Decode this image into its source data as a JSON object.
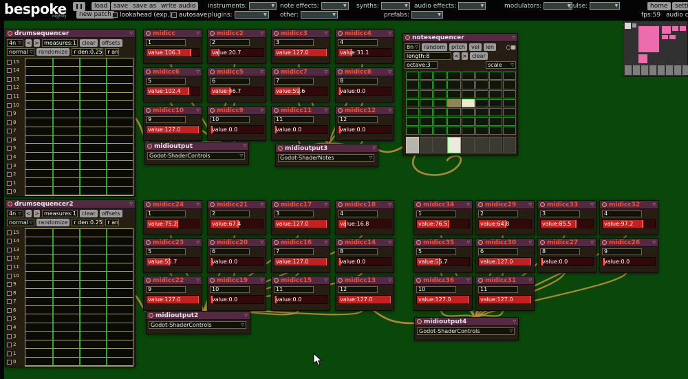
{
  "colors": {
    "canvas": "#0a470a",
    "topbar": "#040404",
    "module_title_bar": "#532a42",
    "midicc_title_text": "#ff4f2e",
    "slider_fill": "#c32020",
    "cable": "#c89440",
    "grid_green": "#3dbb3d",
    "minimap_pink": "#ee6cae"
  },
  "icons": {
    "chevron": "▽",
    "down_arrow": "▼",
    "grid_view": "○▦"
  },
  "topbar": {
    "logo": "bespoke",
    "logo_sub": "nightly",
    "buttons": [
      "load",
      "save",
      "save as",
      "write audio"
    ],
    "new_patch": "new patch",
    "lookahead": "lookahead (exp.)",
    "autosave": "autosave",
    "spawn_row1": [
      "instruments:",
      "note effects:",
      "synths:",
      "audio effects:",
      "modulators:",
      "pulse:"
    ],
    "spawn_row2": [
      "plugins:",
      "other:",
      "prefabs:"
    ],
    "home": "home",
    "settings": "settin",
    "fps": "fps:59",
    "audio": "audio c"
  },
  "drumsequencers": [
    {
      "title": "drumsequencer",
      "interval": "4n",
      "prev": "<",
      "next": ">",
      "measures": "measures:1",
      "clear": "clear",
      "offsets": "offsets",
      "mode": "normal",
      "randomize": "randomize",
      "r_den": "r den:0.25",
      "r_an": "r an",
      "rows": [
        "15",
        "14",
        "13",
        "12",
        "11",
        "10",
        "9",
        "8",
        "7",
        "6",
        "5",
        "4",
        "3",
        "2",
        "1",
        "0"
      ]
    },
    {
      "title": "drumsequencer2",
      "interval": "4n",
      "prev": "<",
      "next": ">",
      "measures": "measures:1",
      "clear": "clear",
      "offsets": "offsets",
      "mode": "normal",
      "randomize": "randomize",
      "r_den": "r den:0.25",
      "r_an": "r an",
      "rows": [
        "15",
        "14",
        "13",
        "12",
        "11",
        "10",
        "9",
        "8",
        "7",
        "6",
        "5",
        "4",
        "3",
        "2",
        "1",
        "0"
      ]
    }
  ],
  "notesequencer": {
    "title": "notesequencer",
    "interval": "8n",
    "random": "random",
    "pitch": "pitch",
    "vel": "vel",
    "len": "len",
    "length": "length:8",
    "prev": "<",
    "next": ">",
    "clear": "clear",
    "octave": "octave:3",
    "scale": "scale",
    "grid": {
      "cols": 8,
      "rows": 7,
      "highlights": [
        {
          "row": 3,
          "col": 3,
          "type": "olive"
        },
        {
          "row": 3,
          "col": 4,
          "type": "bright"
        }
      ],
      "bottom_row": [
        "grey",
        "dark",
        "dark",
        "bright",
        "dark",
        "dark",
        "dark",
        "dark"
      ]
    }
  },
  "midicc_groups": [
    {
      "id": "top",
      "modules": [
        {
          "title": "midicc",
          "num": "1",
          "value": "value:106.3"
        },
        {
          "title": "midicc2",
          "num": "2",
          "value": "value:20.7"
        },
        {
          "title": "midicc3",
          "num": "3",
          "value": "value:127.0"
        },
        {
          "title": "midicc4",
          "num": "4",
          "value": "value:31.1"
        },
        {
          "title": "midicc6",
          "num": "5",
          "value": "value:102.4"
        },
        {
          "title": "midicc5",
          "num": "6",
          "value": "value:46.7"
        },
        {
          "title": "midicc7",
          "num": "7",
          "value": "value:59.6"
        },
        {
          "title": "midicc8",
          "num": "8",
          "value": "value:0.0"
        },
        {
          "title": "midicc10",
          "num": "9",
          "value": "value:127.0"
        },
        {
          "title": "midicc9",
          "num": "10",
          "value": "value:0.0"
        },
        {
          "title": "midicc11",
          "num": "11",
          "value": "value:0.0"
        },
        {
          "title": "midicc12",
          "num": "12",
          "value": "value:0.0"
        }
      ]
    },
    {
      "id": "bottom_left",
      "modules": [
        {
          "title": "midicc24",
          "num": "1",
          "value": "value:75.2"
        },
        {
          "title": "midicc21",
          "num": "2",
          "value": "value:67.4"
        },
        {
          "title": "midicc17",
          "num": "3",
          "value": "value:127.0"
        },
        {
          "title": "midicc18",
          "num": "4",
          "value": "value:16.8"
        },
        {
          "title": "midicc23",
          "num": "5",
          "value": "value:55.7"
        },
        {
          "title": "midicc20",
          "num": "6",
          "value": "value:0.0"
        },
        {
          "title": "midicc16",
          "num": "7",
          "value": "value:127.0"
        },
        {
          "title": "midicc14",
          "num": "8",
          "value": "value:0.0"
        },
        {
          "title": "midicc22",
          "num": "9",
          "value": "value:127.0"
        },
        {
          "title": "midicc19",
          "num": "10",
          "value": "value:0.0"
        },
        {
          "title": "midicc15",
          "num": "11",
          "value": "value:0.0"
        },
        {
          "title": "midicc13",
          "num": "12",
          "value": "value:127.0"
        }
      ]
    },
    {
      "id": "bottom_right",
      "modules": [
        {
          "title": "midicc34",
          "num": "1",
          "value": "value:76.5"
        },
        {
          "title": "midicc29",
          "num": "2",
          "value": "value:64.8"
        },
        {
          "title": "midicc33",
          "num": "3",
          "value": "value:85.5"
        },
        {
          "title": "midicc32",
          "num": "4",
          "value": "value:97.2"
        },
        {
          "title": "midicc35",
          "num": "5",
          "value": "value:55.7"
        },
        {
          "title": "midicc30",
          "num": "6",
          "value": "value:127.0"
        },
        {
          "title": "midicc27",
          "num": "8",
          "value": "value:0.0"
        },
        {
          "title": "midicc26",
          "num": "9",
          "value": "value:0.0"
        },
        {
          "title": "midicc36",
          "num": "10",
          "value": "value:127.0"
        },
        {
          "title": "midicc31",
          "num": "11",
          "value": "value:127.0"
        }
      ]
    }
  ],
  "midioutputs": [
    {
      "title": "midioutput",
      "device": "Godot-ShaderControls"
    },
    {
      "title": "midioutput3",
      "device": "Godot-ShaderNotes"
    },
    {
      "title": "midioutput2",
      "device": "Godot-ShaderControls"
    },
    {
      "title": "midioutput4",
      "device": "Godot-ShaderControls"
    }
  ]
}
